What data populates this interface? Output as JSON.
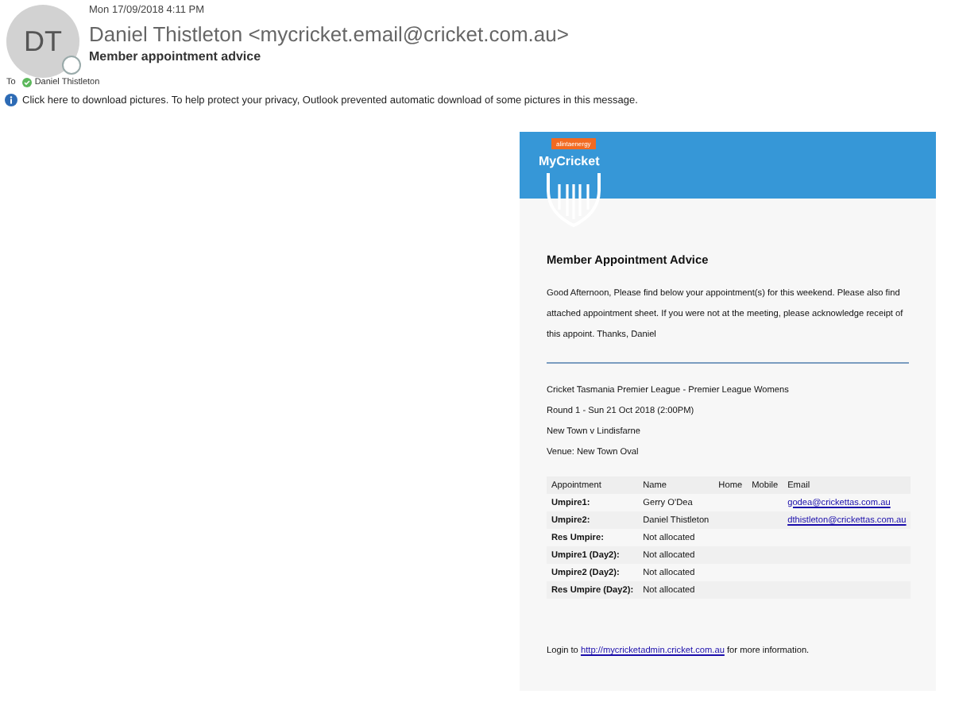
{
  "header": {
    "date": "Mon 17/09/2018 4:11 PM",
    "avatar_initials": "DT",
    "sender": "Daniel Thistleton <mycricket.email@cricket.com.au>",
    "subject": "Member appointment advice",
    "to_label": "To",
    "recipient": "Daniel Thistleton",
    "info": "Click here to download pictures. To help protect your privacy, Outlook prevented automatic download of some pictures in this message."
  },
  "email": {
    "sponsor": "alintaenergy",
    "logo": "MyCricket",
    "title": "Member Appointment Advice",
    "intro": "Good Afternoon, Please find below your appointment(s) for this weekend. Please also find attached appointment sheet. If you were not at the meeting, please acknowledge receipt of this appoint. Thanks, Daniel",
    "competition": "Cricket Tasmania Premier League - Premier League Womens",
    "round": "Round 1 - Sun 21 Oct 2018 (2:00PM)",
    "match": "New Town v Lindisfarne",
    "venue": "Venue: New Town Oval",
    "table": {
      "columns": [
        "Appointment",
        "Name",
        "Home",
        "Mobile",
        "Email"
      ],
      "rows": [
        {
          "appointment": "Umpire1:",
          "name": "Gerry O'Dea",
          "email": "godea@crickettas.com.au"
        },
        {
          "appointment": "Umpire2:",
          "name": "Daniel Thistleton",
          "email": "dthistleton@crickettas.com.au"
        },
        {
          "appointment": "Res Umpire:",
          "name": "Not allocated"
        },
        {
          "appointment": "Umpire1 (Day2):",
          "name": "Not allocated"
        },
        {
          "appointment": "Umpire2 (Day2):",
          "name": "Not allocated"
        },
        {
          "appointment": "Res Umpire (Day2):",
          "name": "Not allocated"
        }
      ]
    },
    "footer_before": "Login to",
    "footer_link": "http://mycricketadmin.cricket.com.au",
    "footer_after": "for more information."
  }
}
